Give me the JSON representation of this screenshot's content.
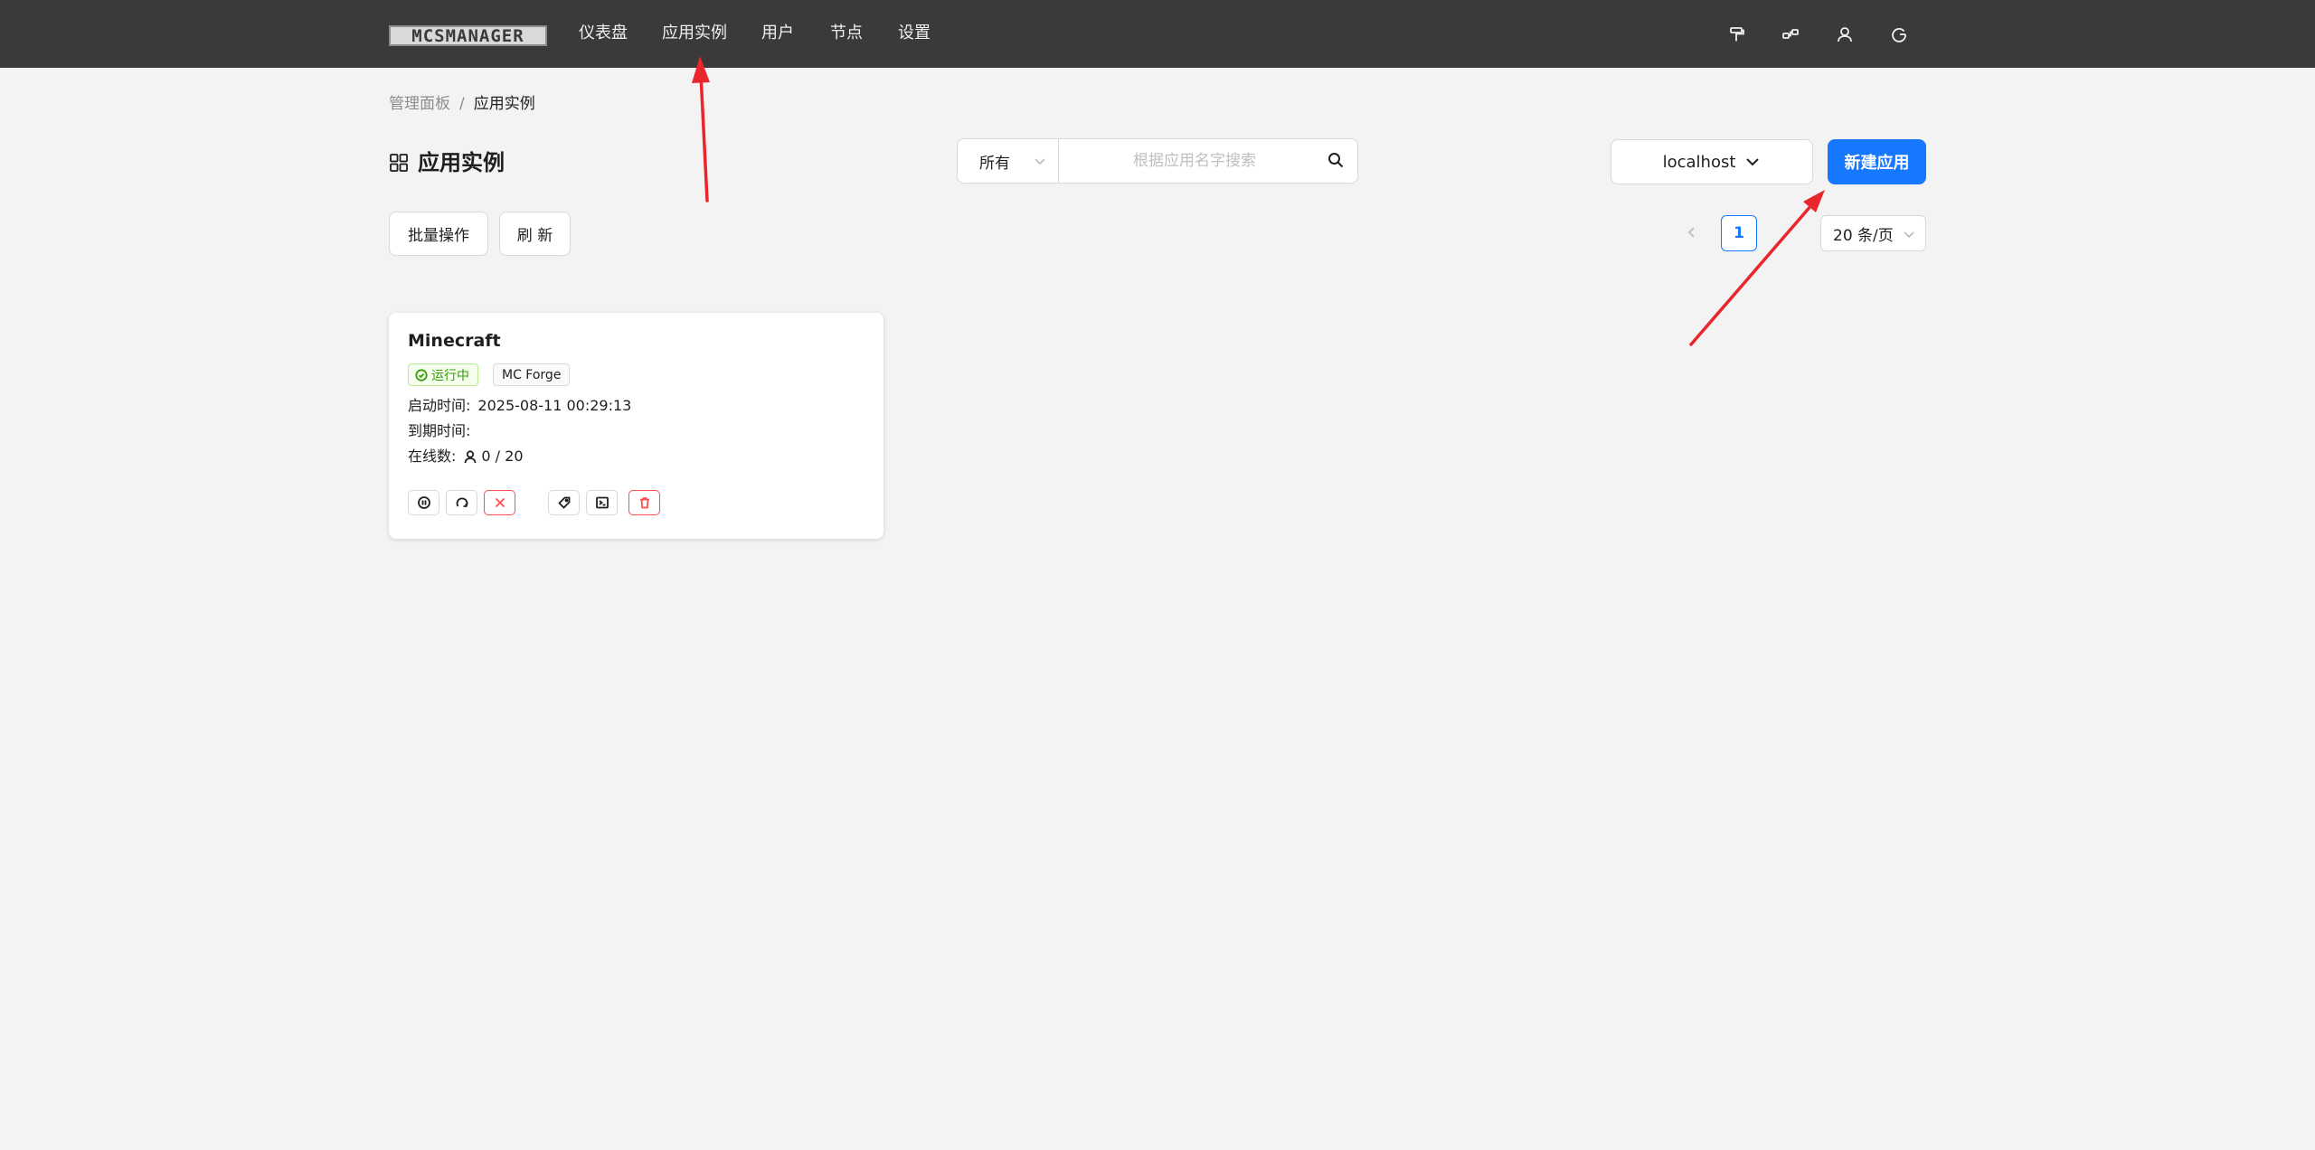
{
  "header": {
    "logo_text": "MCSMANAGER",
    "nav": [
      "仪表盘",
      "应用实例",
      "用户",
      "节点",
      "设置"
    ],
    "icons": [
      "paint-roller-icon",
      "nodes-icon",
      "user-icon",
      "logout-icon"
    ]
  },
  "breadcrumb": {
    "parent": "管理面板",
    "separator": "/",
    "current": "应用实例"
  },
  "page_title": "应用实例",
  "filter": {
    "selected": "所有",
    "search_placeholder": "根据应用名字搜索",
    "search_value": ""
  },
  "node_selector": "localhost",
  "new_button": "新建应用",
  "toolbar": {
    "batch_label": "批量操作",
    "refresh_label": "刷 新"
  },
  "pagination": {
    "current_page": "1",
    "page_size": "20 条/页"
  },
  "instance": {
    "name": "Minecraft",
    "status": "运行中",
    "type": "MC Forge",
    "start_label": "启动时间:",
    "start_time": "2025-08-11 00:29:13",
    "expire_label": "到期时间:",
    "expire_time": "",
    "online_label": "在线数:",
    "online_value": "0 / 20"
  },
  "colors": {
    "header_bg": "#3a3a3a",
    "primary": "#1677ff",
    "danger": "#ff4d4f",
    "success": "#389e0d",
    "annotation": "#e8262c"
  }
}
